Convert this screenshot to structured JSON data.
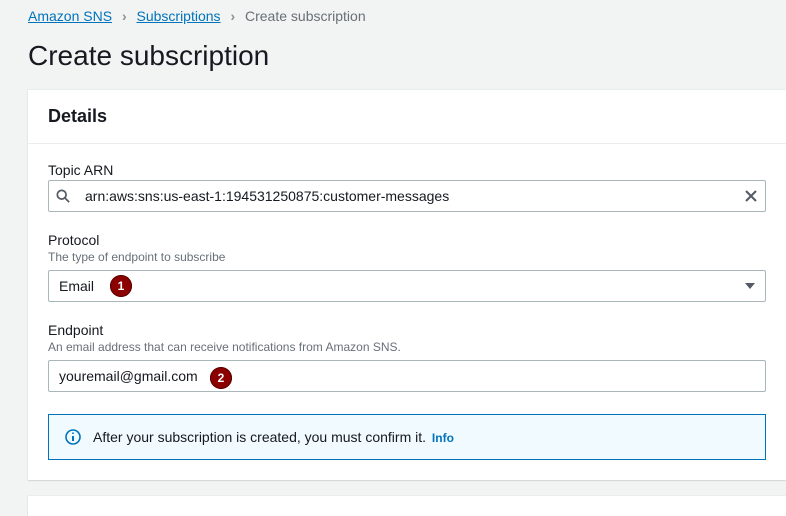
{
  "breadcrumb": {
    "items": [
      {
        "label": "Amazon SNS",
        "link": true
      },
      {
        "label": "Subscriptions",
        "link": true
      },
      {
        "label": "Create subscription",
        "link": false
      }
    ]
  },
  "page": {
    "title": "Create subscription"
  },
  "details": {
    "heading": "Details",
    "topic_arn": {
      "label": "Topic ARN",
      "value": "arn:aws:sns:us-east-1:194531250875:customer-messages"
    },
    "protocol": {
      "label": "Protocol",
      "hint": "The type of endpoint to subscribe",
      "value": "Email"
    },
    "endpoint": {
      "label": "Endpoint",
      "hint": "An email address that can receive notifications from Amazon SNS.",
      "value": "youremail@gmail.com"
    },
    "banner": {
      "text": "After your subscription is created, you must confirm it.",
      "info_label": "Info"
    }
  },
  "annotations": {
    "b1": "1",
    "b2": "2"
  }
}
